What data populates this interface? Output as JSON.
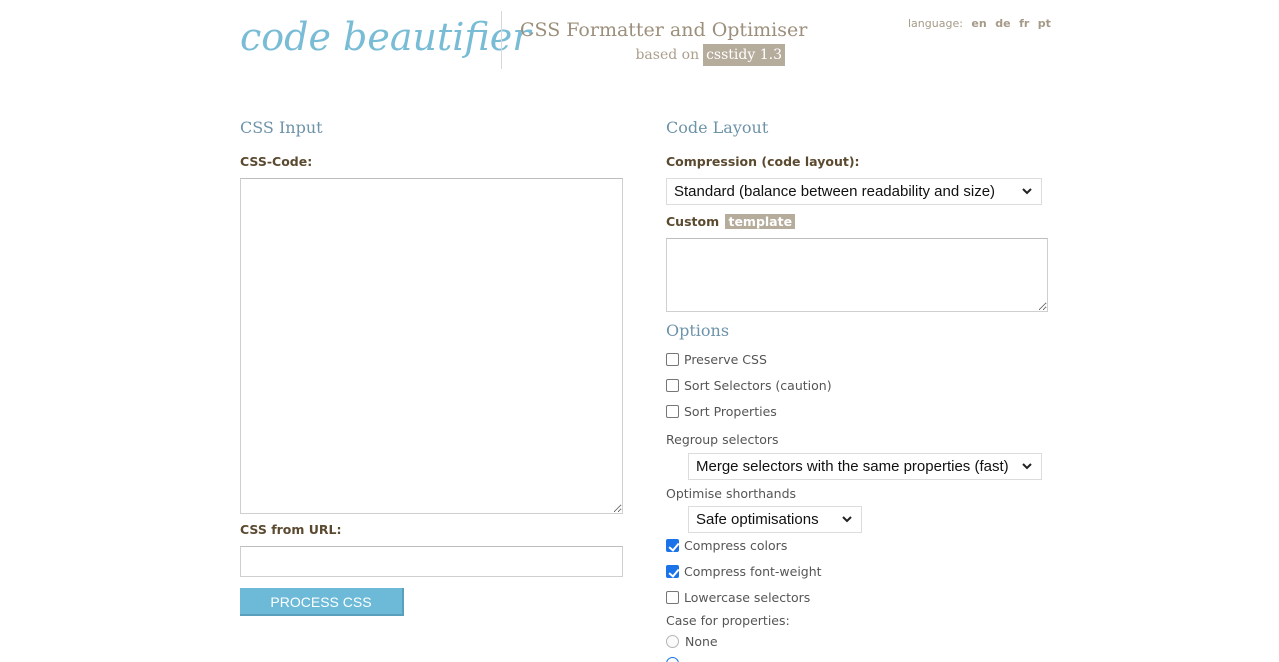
{
  "header": {
    "logo": "code beautifier",
    "subtitle": "CSS Formatter and Optimiser",
    "based_on": "based on",
    "engine_badge": "csstidy 1.3",
    "language_label": "language:",
    "languages": [
      "en",
      "de",
      "fr",
      "pt"
    ]
  },
  "input_section": {
    "title": "CSS Input",
    "code_label": "CSS-Code:",
    "code_value": "",
    "url_label": "CSS from URL:",
    "url_value": "",
    "process_button": "PROCESS CSS"
  },
  "layout_section": {
    "title": "Code Layout",
    "compression_label": "Compression (code layout):",
    "compression_selected": "Standard (balance between readability and size)",
    "custom_label": "Custom",
    "template_badge": "template",
    "template_value": ""
  },
  "options_section": {
    "title": "Options",
    "checkboxes": [
      {
        "label": "Preserve CSS",
        "checked": false
      },
      {
        "label": "Sort Selectors (caution)",
        "checked": false
      },
      {
        "label": "Sort Properties",
        "checked": false
      }
    ],
    "regroup_label": "Regroup selectors",
    "regroup_selected": "Merge selectors with the same properties (fast)",
    "shorthands_label": "Optimise shorthands",
    "shorthands_selected": "Safe optimisations",
    "checkboxes2": [
      {
        "label": "Compress colors",
        "checked": true
      },
      {
        "label": "Compress font-weight",
        "checked": true
      },
      {
        "label": "Lowercase selectors",
        "checked": false
      }
    ],
    "case_label": "Case for properties:",
    "case_options": [
      {
        "label": "None",
        "checked": false
      }
    ]
  }
}
